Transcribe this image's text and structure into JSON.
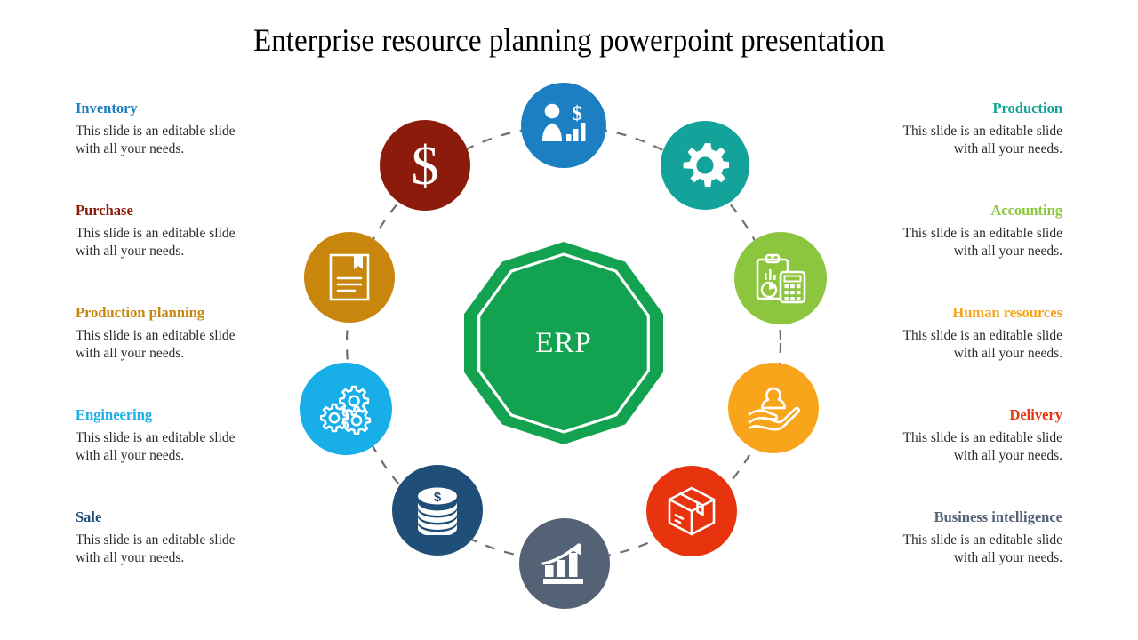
{
  "slide": {
    "title": "Enterprise resource planning powerpoint presentation",
    "center_label": "ERP",
    "center_color": "#13a350",
    "background": "#ffffff",
    "connector_color": "#6e6e6e"
  },
  "left_items": [
    {
      "title": "Inventory",
      "body": "This slide is an editable slide with all your needs.",
      "color": "#1b7fc2"
    },
    {
      "title": "Purchase",
      "body": "This slide is an editable slide with all your needs.",
      "color": "#8d1b0b"
    },
    {
      "title": "Production planning",
      "body": "This slide is an editable slide with all your needs.",
      "color": "#c8860d"
    },
    {
      "title": "Engineering",
      "body": "This slide is an editable slide with all your needs.",
      "color": "#18aee8"
    },
    {
      "title": "Sale",
      "body": "This slide is an editable slide with all your needs.",
      "color": "#1f4e79"
    }
  ],
  "right_items": [
    {
      "title": "Production",
      "body": "This slide is an editable slide with all your needs.",
      "color": "#14a39b"
    },
    {
      "title": "Accounting",
      "body": "This slide is an editable slide with all your needs.",
      "color": "#8cc63e"
    },
    {
      "title": "Human resources",
      "body": "This slide is an editable slide with all your needs.",
      "color": "#f8a51b"
    },
    {
      "title": "Delivery",
      "body": "This slide is an editable slide with all your needs.",
      "color": "#e8330f"
    },
    {
      "title": "Business intelligence",
      "body": "This slide is an editable slide with all your needs.",
      "color": "#546275"
    }
  ],
  "nodes": [
    {
      "id": "inventory",
      "icon": "businessman-dollar-chart-icon",
      "color": "#1b7fc2"
    },
    {
      "id": "production",
      "icon": "gear-icon",
      "color": "#14a39b"
    },
    {
      "id": "accounting",
      "icon": "clipboard-calculator-icon",
      "color": "#8cc63e"
    },
    {
      "id": "human-resources",
      "icon": "hand-person-icon",
      "color": "#f8a51b"
    },
    {
      "id": "delivery",
      "icon": "package-box-icon",
      "color": "#e8330f"
    },
    {
      "id": "business-intelligence",
      "icon": "growth-bar-chart-icon",
      "color": "#546275"
    },
    {
      "id": "sale",
      "icon": "coin-stack-icon",
      "color": "#1f4e79"
    },
    {
      "id": "engineering",
      "icon": "gears-icon",
      "color": "#18aee8"
    },
    {
      "id": "production-planning",
      "icon": "document-bookmark-icon",
      "color": "#c8860d"
    },
    {
      "id": "purchase",
      "icon": "dollar-sign-icon",
      "color": "#8d1b0b"
    }
  ]
}
